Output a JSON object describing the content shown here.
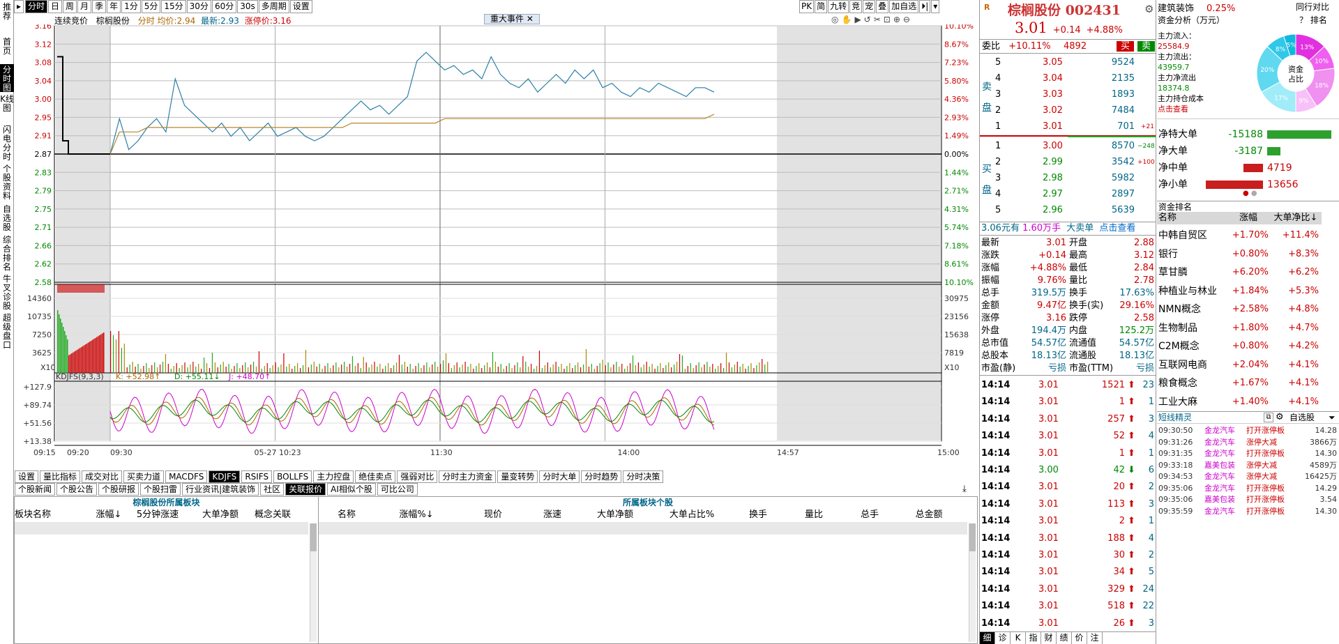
{
  "left_nav": [
    "推荐",
    "首页",
    "分时图",
    "K线图",
    "闪电分时",
    "个股资料",
    "自选股",
    "综合排名",
    "牛叉诊股",
    "超级盘口"
  ],
  "top_tabs": [
    "分时",
    "日",
    "周",
    "月",
    "季",
    "年",
    "1分",
    "5分",
    "15分",
    "30分",
    "60分",
    "30s",
    "多周期",
    "设置"
  ],
  "top_tab_arrow": "▸",
  "chart": {
    "header": {
      "label1": "连续竞价",
      "name": "棕榈股份",
      "ftype": "分时",
      "avg_label": "均价:",
      "avg": "2.94",
      "last_label": "最新:",
      "last": "2.93",
      "limit_label": "涨停价:",
      "limit": "3.16"
    },
    "event_label": "重大事件",
    "close_x": "✕",
    "price_ticks": [
      "3.16",
      "3.12",
      "3.08",
      "3.04",
      "3.00",
      "2.95",
      "2.91",
      "2.87",
      "2.83",
      "2.79",
      "2.75",
      "2.71",
      "2.66",
      "2.62",
      "2.58"
    ],
    "pct_ticks": [
      "10.10%",
      "8.67%",
      "7.23%",
      "5.80%",
      "4.36%",
      "2.93%",
      "1.49%",
      "0.00%",
      "1.44%",
      "2.71%",
      "4.31%",
      "5.74%",
      "7.18%",
      "8.61%",
      "10.10%"
    ],
    "vol_ticks": [
      "14360",
      "10735",
      "7250",
      "3625"
    ],
    "vol_ticks_r": [
      "30975",
      "23156",
      "15638",
      "7819"
    ],
    "vol_unit": "X10",
    "kdj_label": "KDJFS(9,3,3)",
    "kdj_k": "K: +52.98↑",
    "kdj_d": "D: +55.11↓",
    "kdj_j": "J: +48.70↑",
    "kdj_ticks": [
      "+127.9",
      "+89.74",
      "+51.56",
      "+13.38"
    ],
    "time_labels": [
      "09:15",
      "09:20",
      "09:30",
      "05-27 10:23",
      "11:30",
      "14:00",
      "14:57",
      "15:00"
    ],
    "right_tools": [
      "PK",
      "简",
      "九转",
      "竞",
      "宠",
      "叠",
      "加自选"
    ],
    "chart_data": {
      "type": "line",
      "title": "棕榈股份 分时",
      "prev_close": 2.87,
      "ylim": [
        2.58,
        3.16
      ],
      "series": [
        {
          "name": "最新",
          "values": [
            2.87,
            2.95,
            2.88,
            2.9,
            2.93,
            2.95,
            2.92,
            3.04,
            2.98,
            2.96,
            2.94,
            2.92,
            2.94,
            2.91,
            2.93,
            2.9,
            2.92,
            2.94,
            2.91,
            2.92,
            2.93,
            2.91,
            2.9,
            2.91,
            2.93,
            2.95,
            2.97,
            2.99,
            2.97,
            2.98,
            2.96,
            2.98,
            3.0,
            3.08,
            3.1,
            3.08,
            3.06,
            3.07,
            3.05,
            3.06,
            3.04,
            3.09,
            3.05,
            3.03,
            3.02,
            3.04,
            3.01,
            3.03,
            3.05,
            3.03,
            3.06,
            3.04,
            3.06,
            3.02,
            3.03,
            3.01,
            3.0,
            3.02,
            3.01,
            3.03,
            3.02,
            3.01,
            3.0,
            3.02,
            3.02,
            3.01
          ]
        },
        {
          "name": "均价",
          "values": [
            2.87,
            2.92,
            2.92,
            2.92,
            2.93,
            2.93,
            2.93,
            2.93,
            2.93,
            2.93,
            2.93,
            2.93,
            2.93,
            2.93,
            2.93,
            2.93,
            2.93,
            2.93,
            2.93,
            2.93,
            2.93,
            2.93,
            2.93,
            2.93,
            2.93,
            2.93,
            2.94,
            2.94,
            2.94,
            2.94,
            2.94,
            2.94,
            2.94,
            2.94,
            2.94,
            2.94,
            2.95,
            2.95,
            2.95,
            2.95,
            2.95,
            2.95,
            2.95,
            2.95,
            2.95,
            2.95,
            2.95,
            2.95,
            2.95,
            2.95,
            2.95,
            2.95,
            2.95,
            2.95,
            2.95,
            2.95,
            2.95,
            2.95,
            2.95,
            2.95,
            2.95,
            2.95,
            2.95,
            2.95,
            2.95,
            2.96
          ]
        }
      ]
    }
  },
  "bottom_tabs1": [
    "设置",
    "量比指标",
    "成交对比",
    "买卖力道",
    "MACDFS",
    "KDJFS",
    "RSIFS",
    "BOLLFS",
    "主力控盘",
    "绝佳卖点",
    "强弱对比",
    "分时主力资金",
    "量变转势",
    "分时大单",
    "分时趋势",
    "分时决策"
  ],
  "bottom_tabs2": [
    "个股新闻",
    "个股公告",
    "个股研报",
    "个股扫雷",
    "行业资讯|建筑装饰",
    "社区",
    "关联报价",
    "AI相似个股",
    "可比公司"
  ],
  "panel_left": {
    "title": "棕榈股份所属板块",
    "cols": [
      "板块名称",
      "涨幅↓",
      "5分钟涨速",
      "大单净额",
      "概念关联"
    ]
  },
  "panel_right": {
    "title": "所属板块个股",
    "cols": [
      "名称",
      "涨幅%↓",
      "现价",
      "涨速",
      "大单净额",
      "大单占比%",
      "换手",
      "量比",
      "总手",
      "总金额"
    ]
  },
  "quote": {
    "r_mark": "R",
    "name": "棕榈股份",
    "code": "002431",
    "price": "3.01",
    "chg": "+0.14",
    "pct": "+4.88%",
    "wb_label": "委比",
    "wb": "+10.11%",
    "wb_n": "4892",
    "buy": "买",
    "sell": "卖",
    "sell_side": "卖盘",
    "buy_side": "买盘",
    "asks": [
      {
        "l": "5",
        "p": "3.05",
        "v": "9524",
        "d": ""
      },
      {
        "l": "4",
        "p": "3.04",
        "v": "2135",
        "d": ""
      },
      {
        "l": "3",
        "p": "3.03",
        "v": "1893",
        "d": ""
      },
      {
        "l": "2",
        "p": "3.02",
        "v": "7484",
        "d": ""
      },
      {
        "l": "1",
        "p": "3.01",
        "v": "701",
        "d": "+21"
      }
    ],
    "bids": [
      {
        "l": "1",
        "p": "3.00",
        "v": "8570",
        "d": "−248"
      },
      {
        "l": "2",
        "p": "2.99",
        "v": "3542",
        "d": "+100"
      },
      {
        "l": "3",
        "p": "2.98",
        "v": "5982",
        "d": ""
      },
      {
        "l": "4",
        "p": "2.97",
        "v": "2897",
        "d": ""
      },
      {
        "l": "5",
        "p": "2.96",
        "v": "5639",
        "d": ""
      }
    ],
    "big_line": {
      "a": "3.06元有",
      "b": "1.60万手",
      "c": "大卖单",
      "d": "点击查看"
    },
    "stats": [
      [
        "最新",
        "3.01",
        "开盘",
        "2.88"
      ],
      [
        "涨跌",
        "+0.14",
        "最高",
        "3.12"
      ],
      [
        "涨幅",
        "+4.88%",
        "最低",
        "2.84"
      ],
      [
        "振幅",
        "9.76%",
        "量比",
        "2.78"
      ],
      [
        "总手",
        "319.5万",
        "换手",
        "17.63%"
      ],
      [
        "金额",
        "9.47亿",
        "换手(实)",
        "29.16%"
      ],
      [
        "涨停",
        "3.16",
        "跌停",
        "2.58"
      ],
      [
        "外盘",
        "194.4万",
        "内盘",
        "125.2万"
      ],
      [
        "总市值",
        "54.57亿",
        "流通值",
        "54.57亿"
      ],
      [
        "总股本",
        "18.13亿",
        "流通股",
        "18.13亿"
      ],
      [
        "市盈(静)",
        "亏损",
        "市盈(TTM)",
        "亏损"
      ]
    ],
    "ticks": [
      [
        "14:14",
        "3.01",
        "1521",
        "23"
      ],
      [
        "14:14",
        "3.01",
        "1",
        "1"
      ],
      [
        "14:14",
        "3.01",
        "257",
        "3"
      ],
      [
        "14:14",
        "3.01",
        "52",
        "4"
      ],
      [
        "14:14",
        "3.01",
        "1",
        "1"
      ],
      [
        "14:14",
        "3.00",
        "42",
        "6"
      ],
      [
        "14:14",
        "3.01",
        "20",
        "2"
      ],
      [
        "14:14",
        "3.01",
        "113",
        "3"
      ],
      [
        "14:14",
        "3.01",
        "2",
        "1"
      ],
      [
        "14:14",
        "3.01",
        "188",
        "4"
      ],
      [
        "14:14",
        "3.01",
        "30",
        "2"
      ],
      [
        "14:14",
        "3.01",
        "34",
        "5"
      ],
      [
        "14:14",
        "3.01",
        "329",
        "24"
      ],
      [
        "14:14",
        "3.01",
        "518",
        "22"
      ],
      [
        "14:14",
        "3.01",
        "26",
        "3"
      ]
    ],
    "foot_tabs": [
      "细",
      "诊",
      "K",
      "指",
      "财",
      "绩",
      "价",
      "注"
    ]
  },
  "sector": {
    "name": "建筑装饰",
    "pct": "0.25%",
    "link": "同行对比",
    "flow_title": "资金分析（万元）",
    "help": "？",
    "rank": "排名",
    "inflow_label": "主力流入：",
    "inflow": "25584.9",
    "outflow_label": "主力流出：",
    "outflow": "43959.7",
    "net_label": "主力净流出",
    "net": "18374.8",
    "cost_label": "主力持仓成本",
    "cost_link": "点击查看",
    "donut_center": "资金占比",
    "donut": [
      {
        "v": 13,
        "c": "#e030e0",
        "t": "13%"
      },
      {
        "v": 10,
        "c": "#f060f0",
        "t": "10%"
      },
      {
        "v": 18,
        "c": "#f090f0",
        "t": "18%"
      },
      {
        "v": 9,
        "c": "#f8c0f8",
        "t": "9%"
      },
      {
        "v": 17,
        "c": "#a0ecf8",
        "t": "17%"
      },
      {
        "v": 20,
        "c": "#60d8f0",
        "t": "20%"
      },
      {
        "v": 8,
        "c": "#30c8e8",
        "t": "8%"
      },
      {
        "v": 5,
        "c": "#10b8e0",
        "t": "5%"
      }
    ],
    "net_rows": [
      {
        "l": "净特大单",
        "v": "-15188",
        "w": 0.92,
        "c": "#2ea02e"
      },
      {
        "l": "净大单",
        "v": "-3187",
        "w": 0.19,
        "c": "#2ea02e"
      },
      {
        "l": "净中单",
        "v": "4719",
        "w": 0.28,
        "c": "#c81e1e"
      },
      {
        "l": "净小单",
        "v": "13656",
        "w": 0.82,
        "c": "#c81e1e"
      }
    ],
    "rank_title": "资金排名",
    "rank_cols": [
      "名称",
      "涨幅",
      "大单净比↓"
    ],
    "rank_rows": [
      [
        "中韩自贸区",
        "+1.70%",
        "+11.4%"
      ],
      [
        "银行",
        "+0.80%",
        "+8.3%"
      ],
      [
        "草甘膦",
        "+6.20%",
        "+6.2%"
      ],
      [
        "种植业与林业",
        "+1.84%",
        "+5.3%"
      ],
      [
        "NMN概念",
        "+2.58%",
        "+4.8%"
      ],
      [
        "生物制品",
        "+1.80%",
        "+4.7%"
      ],
      [
        "C2M概念",
        "+0.80%",
        "+4.2%"
      ],
      [
        "互联网电商",
        "+2.04%",
        "+4.1%"
      ],
      [
        "粮食概念",
        "+1.67%",
        "+4.1%"
      ],
      [
        "工业大麻",
        "+1.40%",
        "+4.1%"
      ]
    ],
    "jl_title": "短线精灵",
    "jl_sel": "自选股",
    "jl_rows": [
      [
        "09:30:50",
        "金龙汽车",
        "打开涨停板",
        "14.28"
      ],
      [
        "09:31:26",
        "金龙汽车",
        "涨停大减",
        "3866万"
      ],
      [
        "09:31:35",
        "金龙汽车",
        "打开涨停板",
        "14.30"
      ],
      [
        "09:33:18",
        "嘉美包装",
        "涨停大减",
        "4589万"
      ],
      [
        "09:34:53",
        "金龙汽车",
        "涨停大减",
        "16425万"
      ],
      [
        "09:35:06",
        "金龙汽车",
        "打开涨停板",
        "14.29"
      ],
      [
        "09:35:06",
        "嘉美包装",
        "打开涨停板",
        "3.54"
      ],
      [
        "09:35:59",
        "金龙汽车",
        "打开涨停板",
        "14.30"
      ]
    ]
  }
}
